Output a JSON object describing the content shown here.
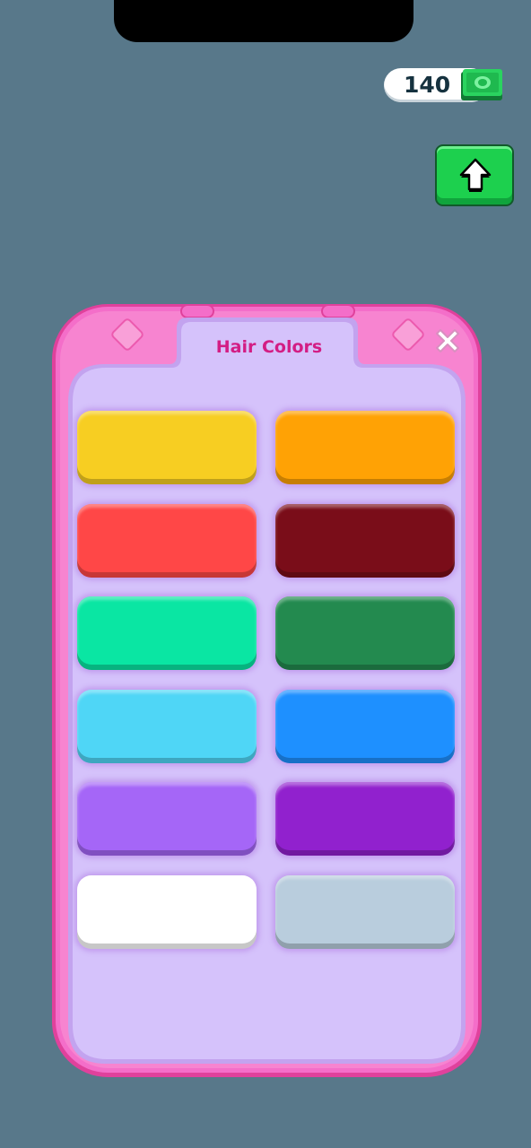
{
  "currency": {
    "amount": "140",
    "icon": "cash-icon"
  },
  "upload_button": {
    "icon": "arrow-up-icon",
    "color": "#1dd04e"
  },
  "panel": {
    "title": "Hair Colors",
    "close_icon": "close-icon",
    "frame_color": "#f46ec9",
    "inner_color": "#d5c2fb",
    "swatches": [
      {
        "name": "yellow",
        "color": "#f7ce22"
      },
      {
        "name": "orange",
        "color": "#ffa205"
      },
      {
        "name": "red",
        "color": "#ff4747"
      },
      {
        "name": "dark-red",
        "color": "#7a0d19"
      },
      {
        "name": "mint-green",
        "color": "#0ae6a3"
      },
      {
        "name": "dark-green",
        "color": "#238a4f"
      },
      {
        "name": "sky-blue",
        "color": "#4fd6f6"
      },
      {
        "name": "blue",
        "color": "#1e90ff"
      },
      {
        "name": "lavender",
        "color": "#a566f7"
      },
      {
        "name": "purple",
        "color": "#9121ce"
      },
      {
        "name": "white",
        "color": "#ffffff"
      },
      {
        "name": "light-gray-blue",
        "color": "#b9cddd"
      }
    ]
  }
}
